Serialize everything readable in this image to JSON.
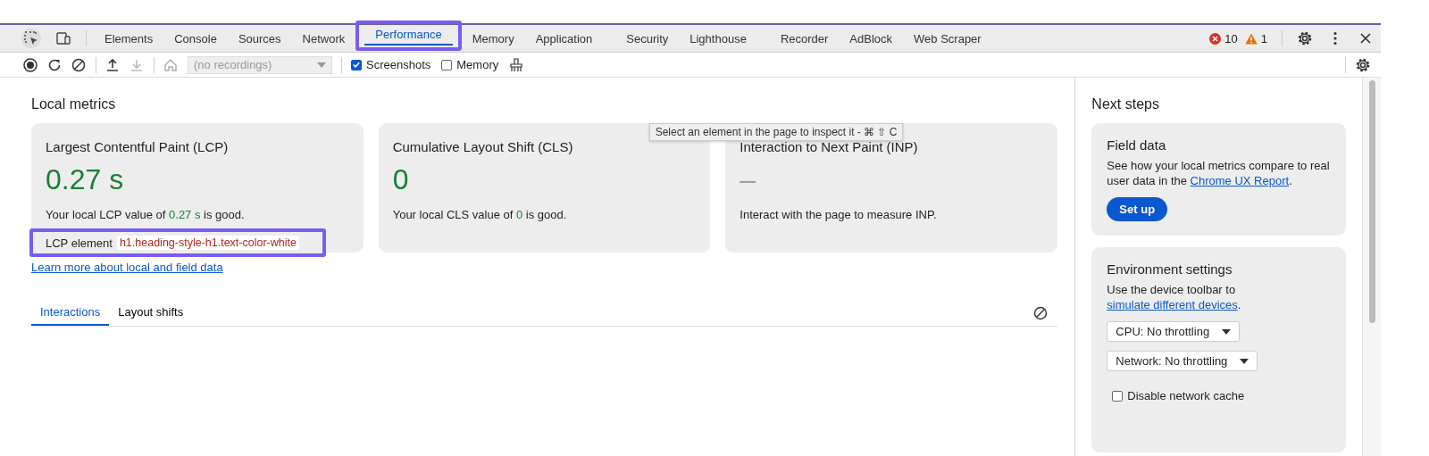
{
  "tabs": [
    {
      "label": "Elements",
      "selected": false,
      "highlighted": false
    },
    {
      "label": "Console",
      "selected": false,
      "highlighted": false
    },
    {
      "label": "Sources",
      "selected": false,
      "highlighted": false
    },
    {
      "label": "Network",
      "selected": false,
      "highlighted": false
    },
    {
      "label": "Performance",
      "selected": true,
      "highlighted": true
    },
    {
      "label": "Memory",
      "selected": false,
      "highlighted": false
    },
    {
      "label": "Application",
      "selected": false,
      "highlighted": false
    },
    {
      "label": "Security",
      "selected": false,
      "highlighted": false
    },
    {
      "label": "Lighthouse",
      "selected": false,
      "highlighted": false
    },
    {
      "label": "Recorder",
      "selected": false,
      "highlighted": false
    },
    {
      "label": "AdBlock",
      "selected": false,
      "highlighted": false
    },
    {
      "label": "Web Scraper",
      "selected": false,
      "highlighted": false
    }
  ],
  "status": {
    "errors": "10",
    "warnings": "1"
  },
  "toolbar": {
    "recordings_placeholder": "(no recordings)",
    "checkboxes": [
      {
        "label": "Screenshots",
        "checked": true
      },
      {
        "label": "Memory",
        "checked": false
      }
    ]
  },
  "local_metrics": {
    "title": "Local metrics",
    "cards": [
      {
        "kind": "lcp",
        "title": "Largest Contentful Paint (LCP)",
        "value": "0.27 s",
        "color": "#188038",
        "desc_before": "Your local LCP value of ",
        "desc_value": "0.27 s",
        "desc_after": " is good.",
        "element_label": "LCP element",
        "element_value": "h1.heading-style-h1.text-color-white",
        "element_highlighted": true
      },
      {
        "kind": "cls",
        "title": "Cumulative Layout Shift (CLS)",
        "value": "0",
        "color": "#188038",
        "desc_before": "Your local CLS value of ",
        "desc_value": "0",
        "desc_after": " is good."
      },
      {
        "kind": "inp",
        "title": "Interaction to Next Paint (INP)",
        "value": "–",
        "color": "#9aa0a6",
        "desc_before": "Interact with the page to measure INP."
      }
    ],
    "tooltip": "Select an element in the page to inspect it - ⌘ ⇧ C",
    "learn_more": "Learn more about local and field data"
  },
  "subtabs": [
    {
      "label": "Interactions",
      "selected": true
    },
    {
      "label": "Layout shifts",
      "selected": false
    }
  ],
  "next_steps": {
    "title": "Next steps",
    "field_data": {
      "title": "Field data",
      "text": "See how your local metrics compare to real user data in the ",
      "link": "Chrome UX Report",
      "text_after": ".",
      "button": "Set up"
    },
    "environment": {
      "title": "Environment settings",
      "text": "Use the device toolbar to ",
      "link": "simulate different devices",
      "text_after": ".",
      "selects": [
        "CPU: No throttling",
        "Network: No throttling"
      ],
      "checkbox": {
        "label": "Disable network cache",
        "checked": false
      }
    }
  }
}
